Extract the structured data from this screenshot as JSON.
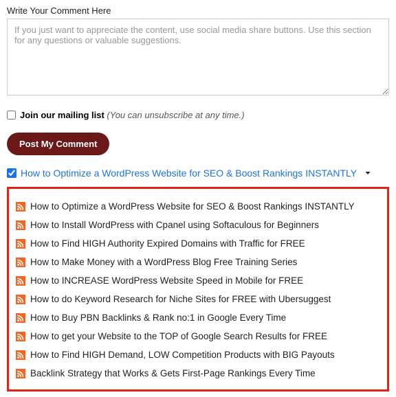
{
  "comment": {
    "label": "Write Your Comment Here",
    "placeholder": "If you just want to appreciate the content, use social media share buttons. Use this section for any questions or valuable suggestions."
  },
  "mailing": {
    "bold": "Join our mailing list",
    "note": "(You can unsubscribe at any time.)"
  },
  "submit": {
    "label": "Post My Comment"
  },
  "current": {
    "title": "How to Optimize a WordPress Website for SEO & Boost Rankings INSTANTLY"
  },
  "feed": {
    "items": [
      {
        "title": "How to Optimize a WordPress Website for SEO & Boost Rankings INSTANTLY"
      },
      {
        "title": "How to Install WordPress with Cpanel using Softaculous for Beginners"
      },
      {
        "title": "How to Find HIGH Authority Expired Domains with Traffic for FREE"
      },
      {
        "title": "How to Make Money with a WordPress Blog Free Training Series"
      },
      {
        "title": "How to INCREASE WordPress Website Speed in Mobile for FREE"
      },
      {
        "title": "How to do Keyword Research for Niche Sites for FREE with Ubersuggest"
      },
      {
        "title": "How to Buy PBN Backlinks & Rank no:1 in Google Every Time"
      },
      {
        "title": "How to get your Website to the TOP of Google Search Results for FREE"
      },
      {
        "title": "How to Find HIGH Demand, LOW Competition Products with BIG Payouts"
      },
      {
        "title": "Backlink Strategy that Works & Gets First-Page Rankings Every Time"
      }
    ]
  }
}
